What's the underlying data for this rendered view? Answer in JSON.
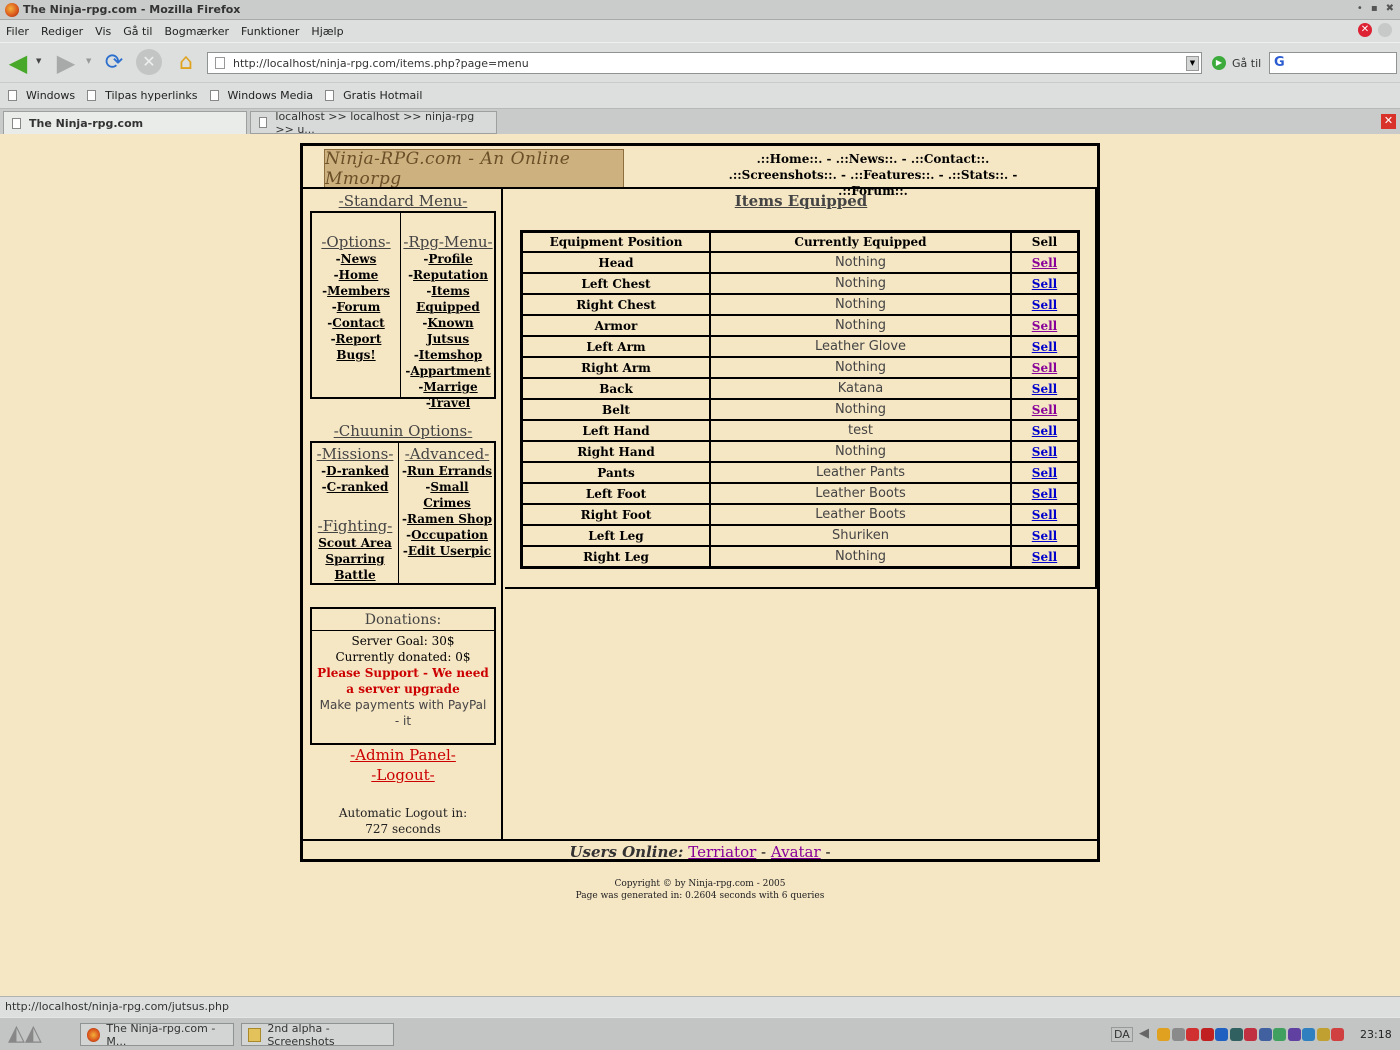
{
  "window": {
    "title": "The Ninja-rpg.com - Mozilla Firefox",
    "controls": [
      "•",
      "▪",
      "✖"
    ]
  },
  "menubar": {
    "items": [
      "Filer",
      "Rediger",
      "Vis",
      "Gå til",
      "Bogmærker",
      "Funktioner",
      "Hjælp"
    ]
  },
  "navbar": {
    "url": "http://localhost/ninja-rpg.com/items.php?page=menu",
    "go_label": "Gå til"
  },
  "bookmarks": [
    "Windows",
    "Tilpas hyperlinks",
    "Windows Media",
    "Gratis Hotmail"
  ],
  "tabs": [
    {
      "label": "The Ninja-rpg.com",
      "active": true
    },
    {
      "label": "localhost >> localhost >> ninja-rpg  >> u...",
      "active": false
    }
  ],
  "site": {
    "logo": "Ninja-RPG.com - An Online Mmorpg",
    "topnav": [
      ".::Home::.",
      ".::News::.",
      ".::Contact::.",
      ".::Screenshots::.",
      ".::Features::.",
      ".::Stats::.",
      ".::Forum::."
    ]
  },
  "standard_menu": {
    "title": "-Standard Menu-",
    "options": {
      "title": "-Options-",
      "links": [
        "News",
        "Home",
        "Members",
        "Forum",
        "Contact",
        "Report Bugs!"
      ]
    },
    "rpg": {
      "title": "-Rpg-Menu-",
      "links": [
        "Profile",
        "Reputation",
        "Items Equipped",
        "Known Jutsus",
        "Itemshop",
        "Appartment",
        "Marrige",
        "Travel"
      ]
    }
  },
  "chunnin": {
    "title": "-Chuunin Options-",
    "missions": {
      "title": "-Missions-",
      "links": [
        "D-ranked",
        "C-ranked"
      ]
    },
    "fighting": {
      "title": "-Fighting-",
      "links": [
        "Scout Area",
        "Sparring",
        "Battle"
      ]
    },
    "advanced": {
      "title": "-Advanced-",
      "links": [
        "Run Errands",
        "Small Crimes",
        "Ramen Shop",
        "Occupation",
        "Edit Userpic"
      ]
    }
  },
  "donations": {
    "title": "Donations:",
    "goal": "Server Goal: 30$",
    "donated": "Currently donated: 0$",
    "support": "Please Support - We need a server upgrade",
    "paypal": "Make payments with PayPal - it"
  },
  "admin_panel": "-Admin Panel-",
  "logout": "-Logout-",
  "auto_logout": {
    "label": "Automatic Logout in:",
    "value": "727 seconds"
  },
  "items": {
    "title": "Items Equipped",
    "columns": [
      "Equipment Position",
      "Currently Equipped",
      "Sell"
    ],
    "rows": [
      {
        "position": "Head",
        "equipped": "Nothing",
        "sell": "Sell",
        "visited": true
      },
      {
        "position": "Left Chest",
        "equipped": "Nothing",
        "sell": "Sell",
        "visited": false
      },
      {
        "position": "Right Chest",
        "equipped": "Nothing",
        "sell": "Sell",
        "visited": false
      },
      {
        "position": "Armor",
        "equipped": "Nothing",
        "sell": "Sell",
        "visited": true
      },
      {
        "position": "Left Arm",
        "equipped": "Leather Glove",
        "sell": "Sell",
        "visited": false
      },
      {
        "position": "Right Arm",
        "equipped": "Nothing",
        "sell": "Sell",
        "visited": true
      },
      {
        "position": "Back",
        "equipped": "Katana",
        "sell": "Sell",
        "visited": false
      },
      {
        "position": "Belt",
        "equipped": "Nothing",
        "sell": "Sell",
        "visited": true
      },
      {
        "position": "Left Hand",
        "equipped": "test",
        "sell": "Sell",
        "visited": false
      },
      {
        "position": "Right Hand",
        "equipped": "Nothing",
        "sell": "Sell",
        "visited": false
      },
      {
        "position": "Pants",
        "equipped": "Leather Pants",
        "sell": "Sell",
        "visited": false
      },
      {
        "position": "Left Foot",
        "equipped": "Leather Boots",
        "sell": "Sell",
        "visited": false
      },
      {
        "position": "Right Foot",
        "equipped": "Leather Boots",
        "sell": "Sell",
        "visited": false
      },
      {
        "position": "Left Leg",
        "equipped": "Shuriken",
        "sell": "Sell",
        "visited": false
      },
      {
        "position": "Right Leg",
        "equipped": "Nothing",
        "sell": "Sell",
        "visited": false
      }
    ]
  },
  "users_online": {
    "label": "Users Online:",
    "users": [
      "Terriator",
      "Avatar"
    ]
  },
  "copyright": {
    "line1": "Copyright © by Ninja-rpg.com - 2005",
    "line2": "Page was generated in: 0.2604 seconds with 6 queries"
  },
  "statusbar": "http://localhost/ninja-rpg.com/jutsus.php",
  "taskbar": {
    "buttons": [
      "The Ninja-rpg.com - M...",
      "2nd alpha - Screenshots"
    ],
    "lang": "DA",
    "clock": "23:18",
    "tray_colors": [
      "#e0a020",
      "#8a8a8a",
      "#d03030",
      "#c02020",
      "#2060c0",
      "#306060",
      "#c03040",
      "#4060a0",
      "#40a060",
      "#6040a0",
      "#3080c0",
      "#c0a030",
      "#d04040"
    ]
  }
}
